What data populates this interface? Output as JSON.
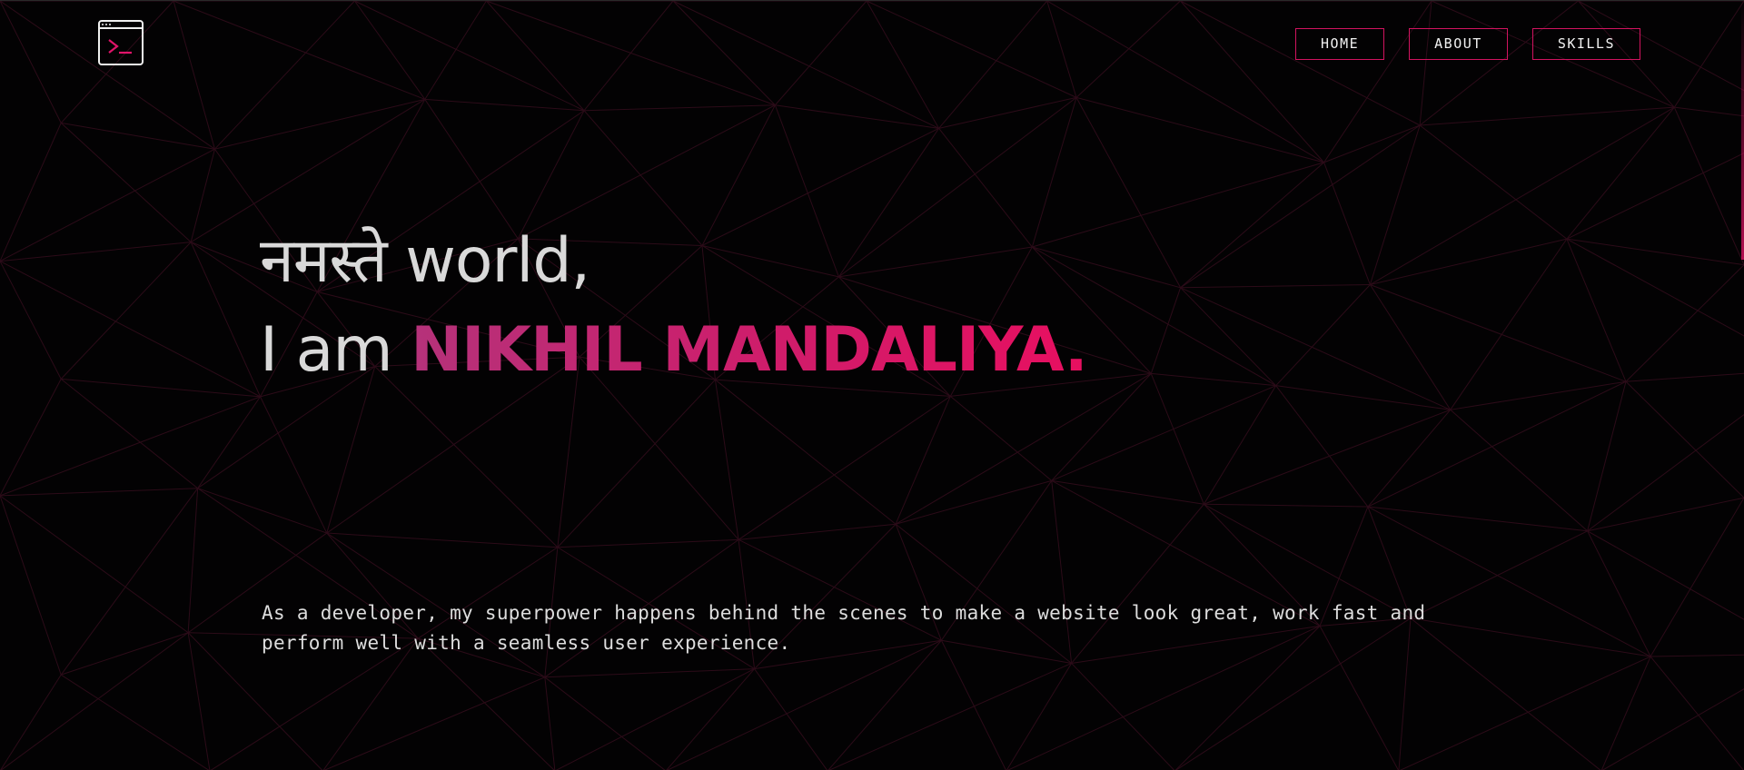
{
  "header": {
    "logo_icon": "terminal-window-icon",
    "nav": [
      {
        "label": "HOME"
      },
      {
        "label": "ABOUT"
      },
      {
        "label": "SKILLS"
      }
    ]
  },
  "hero": {
    "greeting_native": "नमस्ते",
    "greeting_rest": "world,",
    "intro": "I am",
    "name": "NIKHIL MANDALIYA."
  },
  "description": "As a developer, my superpower happens behind the scenes to make a website look great, work fast and perform well with a seamless user experience.",
  "colors": {
    "background": "#030203",
    "accent": "#d1135f",
    "text": "#d9d9d9"
  }
}
